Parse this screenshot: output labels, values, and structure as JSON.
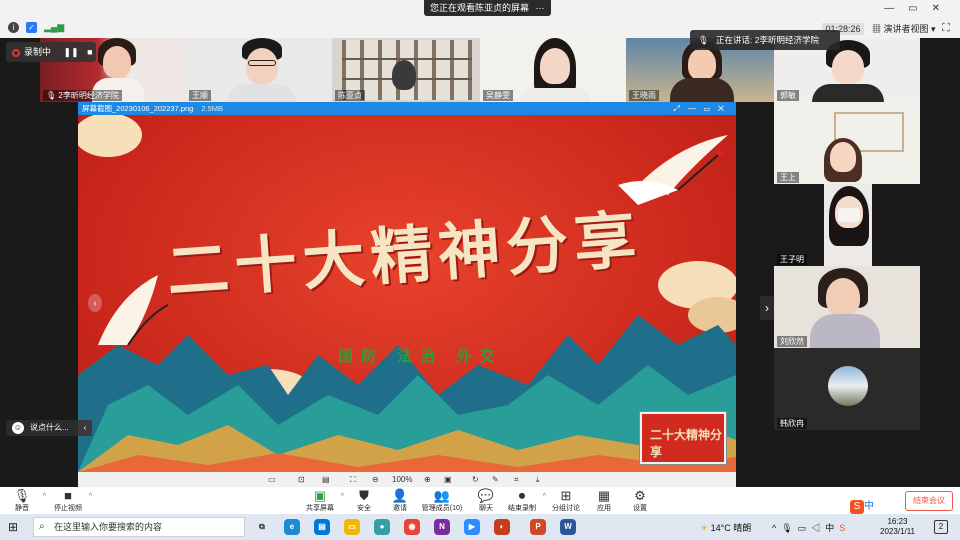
{
  "top": {
    "banner": "您正在观看陈亚贞的屏幕",
    "timer": "01:28:26",
    "view_label": "演讲者视图",
    "recording_label": "录制中",
    "speaking_label": "正在讲话: 2李昕明经济学院"
  },
  "participants_top": [
    {
      "name": "2李昕明经济学院"
    },
    {
      "name": "王顺"
    },
    {
      "name": "陈亚贞"
    },
    {
      "name": "吴静雯"
    },
    {
      "name": "王晓雨"
    },
    {
      "name": "郭敏"
    }
  ],
  "participants_side": [
    {
      "name": "王上"
    },
    {
      "name": "王子明"
    },
    {
      "name": "刘欣然"
    },
    {
      "name": "韩欣冉"
    }
  ],
  "share": {
    "file_name": "屏幕截图_20230106_202237.png",
    "file_size": "2.5MB",
    "poster_title": "二十大精神分享",
    "poster_subtitle": "国防 法治 外交",
    "thumb_title": "二十大精神分享",
    "zoom": "100%"
  },
  "chat_placeholder": "说点什么...",
  "toolbar": [
    {
      "label": "静音",
      "icon": "mic-icon"
    },
    {
      "label": "停止视频",
      "icon": "video-icon"
    },
    {
      "label": "共享屏幕",
      "icon": "share-screen-icon"
    },
    {
      "label": "安全",
      "icon": "shield-icon"
    },
    {
      "label": "邀请",
      "icon": "invite-icon"
    },
    {
      "label": "管理成员(10)",
      "icon": "members-icon"
    },
    {
      "label": "聊天",
      "icon": "chat-icon"
    },
    {
      "label": "结束录制",
      "icon": "stop-record-icon"
    },
    {
      "label": "分组讨论",
      "icon": "breakout-icon"
    },
    {
      "label": "应用",
      "icon": "apps-icon"
    },
    {
      "label": "设置",
      "icon": "gear-icon"
    }
  ],
  "end_meeting": "结束会议",
  "ime": {
    "lang": "中"
  },
  "taskbar": {
    "search_placeholder": "在这里输入你要搜索的内容",
    "temperature": "14°C",
    "weather": "晴朗",
    "time": "16:23",
    "date": "2023/1/11",
    "notif_count": "2"
  },
  "colors": {
    "share_bar": "#1e88e5",
    "poster_red": "#c9261c",
    "accent_green": "#2f9c3a"
  }
}
